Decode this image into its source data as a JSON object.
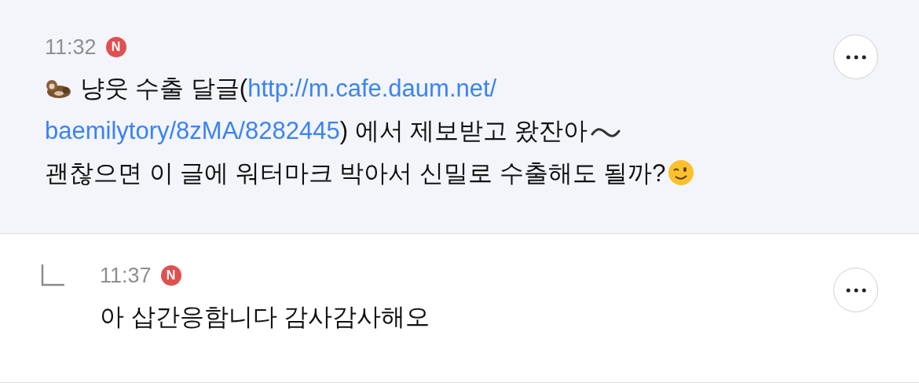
{
  "comments": [
    {
      "kind": "comment",
      "time": "11:32",
      "badge": "N",
      "highlighted": true,
      "lines": [
        [
          {
            "kind": "otter"
          },
          {
            "kind": "text",
            "text": " 냥웃 수출 달글("
          },
          {
            "kind": "link",
            "text": "http://m.cafe.daum.net/"
          }
        ],
        [
          {
            "kind": "link",
            "text": "baemilytory/8zMA/8282445"
          },
          {
            "kind": "text",
            "text": ") 에서 제보받고 왔잔아"
          },
          {
            "kind": "wave"
          }
        ],
        [
          {
            "kind": "text",
            "text": "괜찮으면 이 글에 워터마크 박아서 신밀로 수출해도 될까?"
          },
          {
            "kind": "wink"
          }
        ]
      ]
    },
    {
      "kind": "reply",
      "time": "11:37",
      "badge": "N",
      "highlighted": false,
      "lines": [
        [
          {
            "kind": "text",
            "text": "아 삽간응함니다 감사감사해오"
          }
        ]
      ]
    }
  ]
}
